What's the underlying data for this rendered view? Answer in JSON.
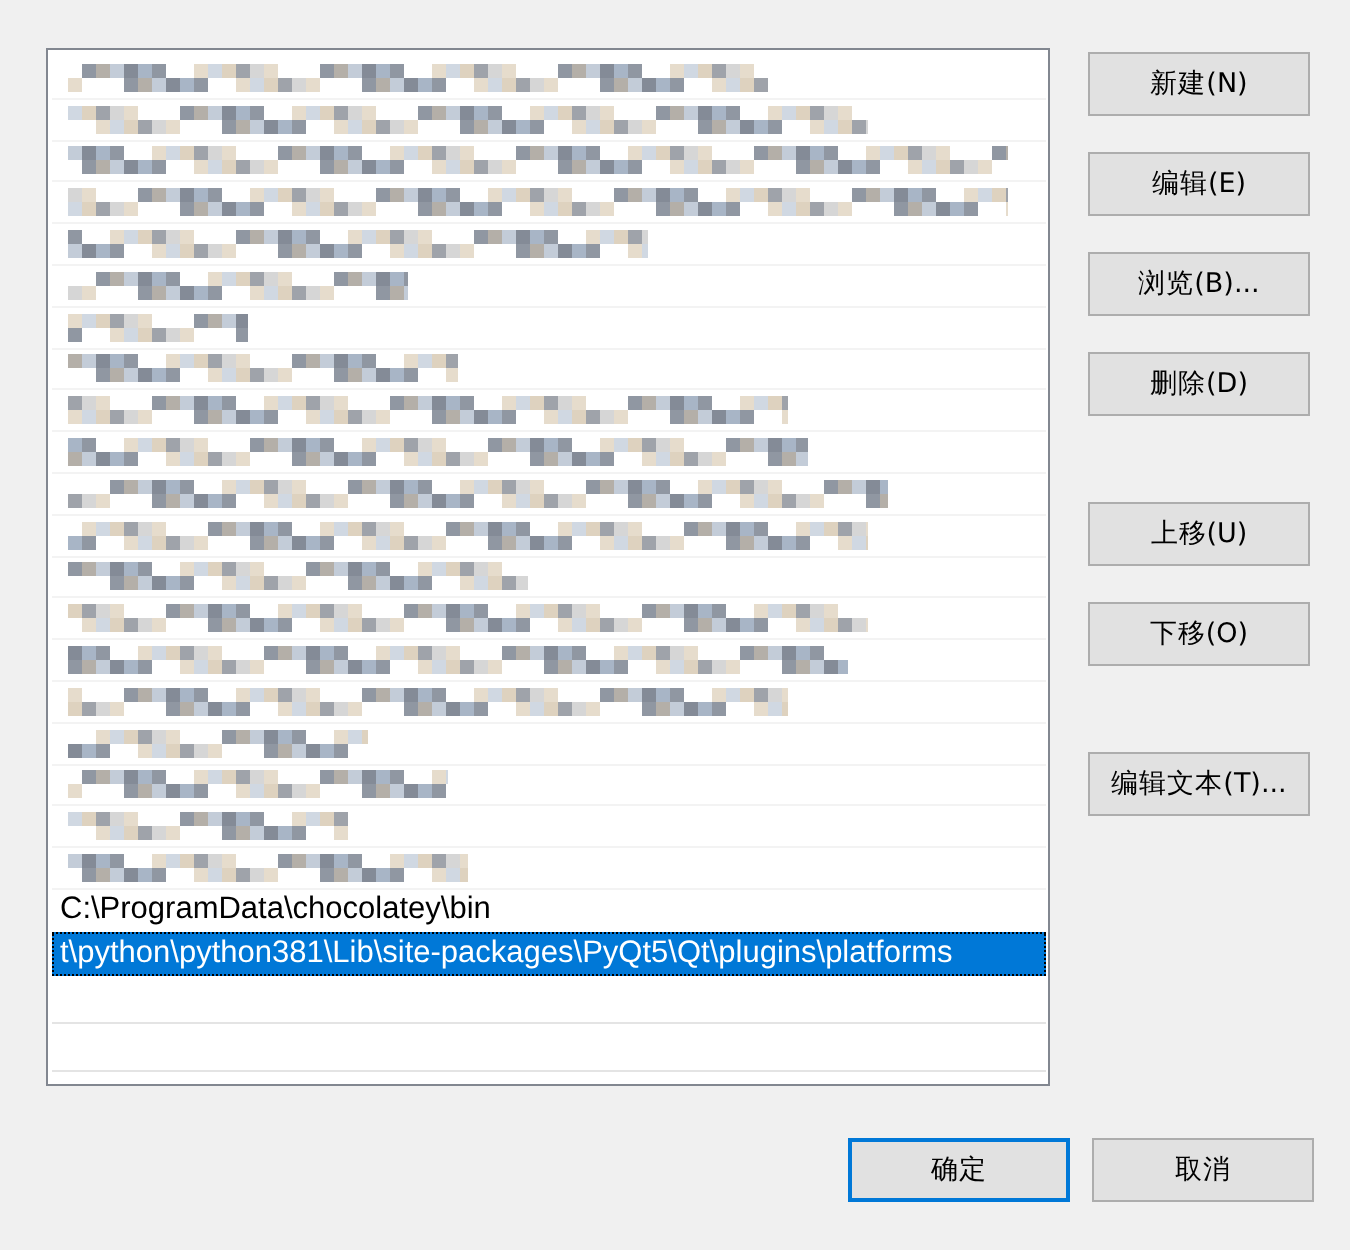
{
  "path_list": {
    "rows": [
      {
        "kind": "redacted"
      },
      {
        "kind": "redacted"
      },
      {
        "kind": "redacted"
      },
      {
        "kind": "redacted"
      },
      {
        "kind": "redacted"
      },
      {
        "kind": "redacted"
      },
      {
        "kind": "redacted"
      },
      {
        "kind": "redacted"
      },
      {
        "kind": "redacted"
      },
      {
        "kind": "redacted"
      },
      {
        "kind": "redacted"
      },
      {
        "kind": "redacted"
      },
      {
        "kind": "redacted"
      },
      {
        "kind": "redacted"
      },
      {
        "kind": "redacted"
      },
      {
        "kind": "redacted"
      },
      {
        "kind": "redacted"
      },
      {
        "kind": "redacted"
      },
      {
        "kind": "redacted"
      },
      {
        "kind": "redacted"
      },
      {
        "kind": "text",
        "text": "C:\\ProgramData\\chocolatey\\bin",
        "selected": false
      },
      {
        "kind": "text",
        "text": "t\\python\\python381\\Lib\\site-packages\\PyQt5\\Qt\\plugins\\platforms",
        "selected": true
      },
      {
        "kind": "empty"
      },
      {
        "kind": "empty"
      }
    ]
  },
  "side_buttons": [
    {
      "label": "新建(N)"
    },
    {
      "label": "编辑(E)"
    },
    {
      "label": "浏览(B)..."
    },
    {
      "label": "删除(D)"
    },
    {
      "label": "上移(U)"
    },
    {
      "label": "下移(O)"
    },
    {
      "label": "编辑文本(T)..."
    }
  ],
  "footer_buttons": [
    {
      "label": "确定",
      "focused": true
    },
    {
      "label": "取消",
      "focused": false
    }
  ]
}
